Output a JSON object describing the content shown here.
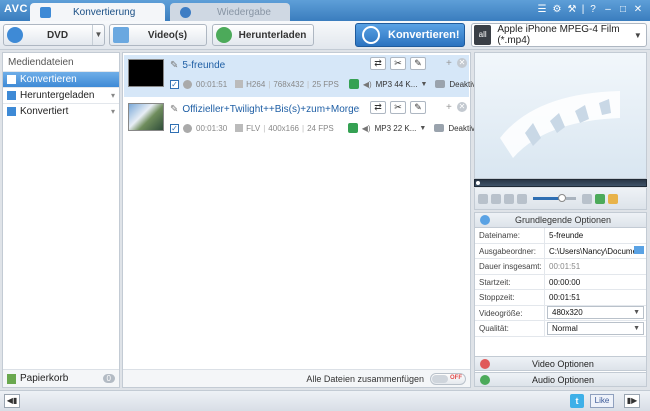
{
  "app": {
    "logo": "AVC"
  },
  "tabs": [
    {
      "label": "Konvertierung",
      "active": true
    },
    {
      "label": "Wiedergabe",
      "active": false
    }
  ],
  "window_controls": [
    "☰",
    "⚙",
    "⚒",
    "|",
    "?",
    "–",
    "□",
    "✕"
  ],
  "toolbar": {
    "dvd_label": "DVD",
    "video_label": "Video(s)",
    "download_label": "Herunterladen",
    "convert_label": "Konvertieren!",
    "profile_icon": "all",
    "profile_label": "Apple iPhone MPEG-4 Film (*.mp4)"
  },
  "sidebar": {
    "title": "Mediendateien",
    "items": [
      {
        "label": "Konvertieren",
        "selected": true
      },
      {
        "label": "Heruntergeladen",
        "selected": false
      },
      {
        "label": "Konvertiert",
        "selected": false
      }
    ],
    "trash_label": "Papierkorb",
    "trash_count": "0"
  },
  "files": [
    {
      "name": "5-freunde",
      "duration": "00:01:51",
      "codec": "H264",
      "resolution": "768x432",
      "fps": "25 FPS",
      "audio": "MP3 44 K...",
      "subtitle": "Deaktivi..."
    },
    {
      "name": "Offizieller+Twilight++Bis(s)+zum+Morgengrauen+T...",
      "duration": "00:01:30",
      "codec": "FLV",
      "resolution": "400x166",
      "fps": "24 FPS",
      "audio": "MP3 22 K...",
      "subtitle": "Deaktivi..."
    }
  ],
  "merge": {
    "label": "Alle Dateien zusammenfügen",
    "toggle": "OFF"
  },
  "options": {
    "basic_title": "Grundlegende Optionen",
    "props": [
      {
        "key": "Dateiname:",
        "value": "5-freunde"
      },
      {
        "key": "Ausgabeordner:",
        "value": "C:\\Users\\Nancy\\Docume..."
      },
      {
        "key": "Dauer insgesamt:",
        "value": "00:01:51"
      },
      {
        "key": "Startzeit:",
        "value": "00:00:00"
      },
      {
        "key": "Stoppzeit:",
        "value": "00:01:51"
      },
      {
        "key": "Videogröße:",
        "value": "480x320"
      },
      {
        "key": "Qualität:",
        "value": "Normal"
      }
    ],
    "video_title": "Video Optionen",
    "audio_title": "Audio Optionen"
  },
  "statusbar": {
    "twitter": "t",
    "like": "Like"
  },
  "colors": {
    "accent": "#3e8ad6",
    "title_bar": "#3a7dbe",
    "audio_green": "#35a153"
  }
}
